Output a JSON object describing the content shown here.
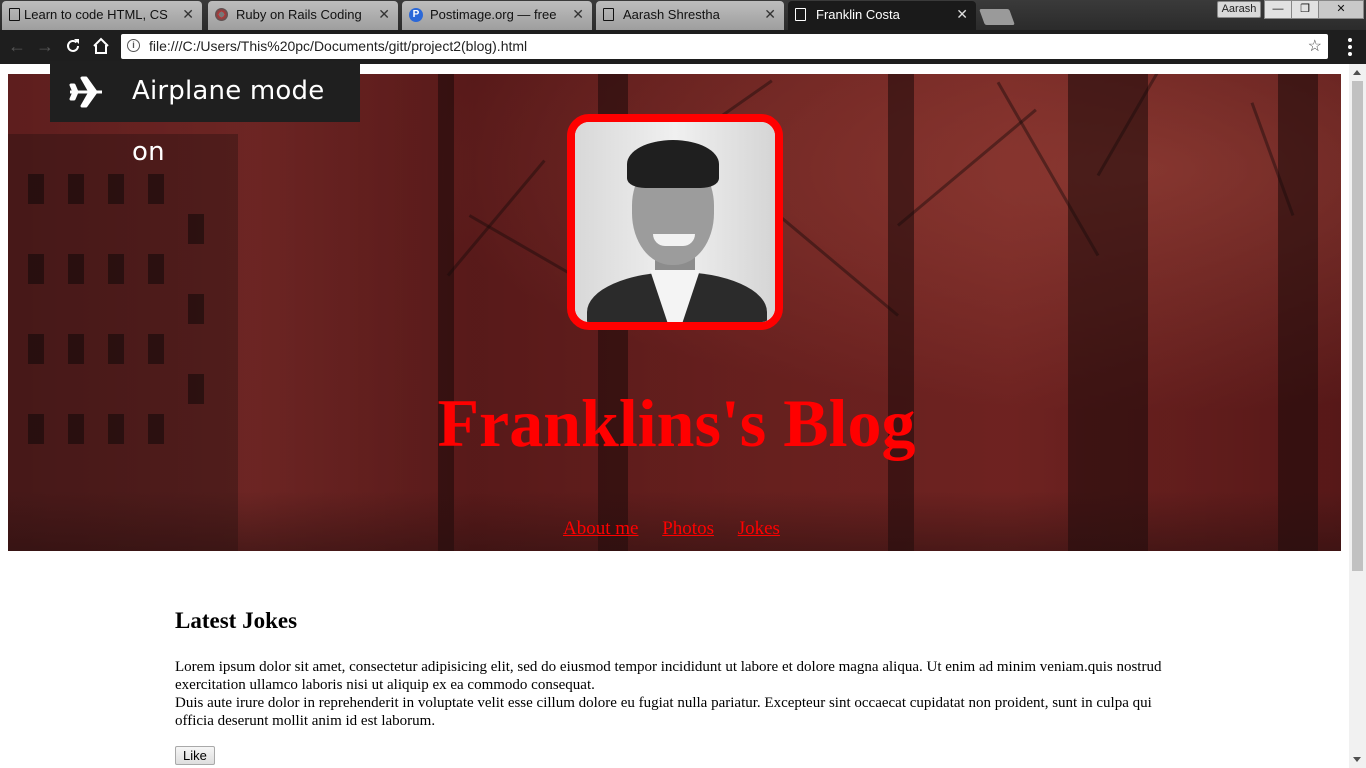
{
  "browser": {
    "tabs": [
      {
        "title": "Learn to code HTML, CSS",
        "icon": "page-icon",
        "active": false
      },
      {
        "title": "Ruby on Rails Coding Bo",
        "icon": "ruby-icon",
        "active": false
      },
      {
        "title": "Postimage.org — free im",
        "icon": "postimage-icon",
        "active": false
      },
      {
        "title": "Aarash Shrestha",
        "icon": "page-icon",
        "active": false
      },
      {
        "title": "Franklin Costa",
        "icon": "page-icon",
        "active": true
      }
    ],
    "profile_name": "Aarash",
    "url": "file:///C:/Users/This%20pc/Documents/gitt/project2(blog).html",
    "close_glyph": "✕"
  },
  "toast": {
    "text": "Airplane mode on",
    "icon": "airplane-icon"
  },
  "page": {
    "title": "Franklins's Blog",
    "nav": [
      "About me",
      "Photos",
      "Jokes"
    ],
    "section_heading": "Latest Jokes",
    "paragraph_1": "Lorem ipsum dolor sit amet, consectetur adipisicing elit, sed do eiusmod tempor incididunt ut labore et dolore magna aliqua. Ut enim ad minim veniam.quis nostrud exercitation ullamco laboris nisi ut aliquip ex ea commodo consequat.",
    "paragraph_2": "Duis aute irure dolor in reprehenderit in voluptate velit esse cillum dolore eu fugiat nulla pariatur. Excepteur sint occaecat cupidatat non proident, sunt in culpa qui officia deserunt mollit anim id est laborum.",
    "like_label": "Like",
    "accent_color": "#ff0000"
  }
}
